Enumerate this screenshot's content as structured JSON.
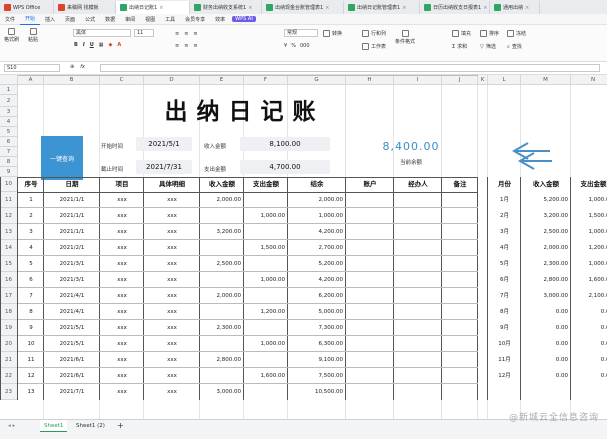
{
  "window_tabs": [
    {
      "label": "WPS Office",
      "icon": "wps-icon"
    },
    {
      "label": "来稿网 找模板",
      "icon": "docer-icon"
    },
    {
      "label": "出纳日记账1",
      "icon": "sheet-icon"
    },
    {
      "label": "财务出纳收支系统1",
      "icon": "sheet-icon"
    },
    {
      "label": "出纳现金台账管理表1",
      "icon": "sheet-icon"
    },
    {
      "label": "出纳日记账管理表1",
      "icon": "sheet-icon"
    },
    {
      "label": "日历出纳收支日报表1",
      "icon": "sheet-icon"
    },
    {
      "label": "通用出纳",
      "icon": "sheet-icon"
    }
  ],
  "menu": [
    "文件",
    "开始",
    "插入",
    "页面",
    "公式",
    "数据",
    "审阅",
    "视图",
    "工具",
    "会员专享",
    "效率"
  ],
  "menu_active": "开始",
  "ai_label": "WPS AI",
  "ribbon": {
    "format_painter": "格式刷",
    "paste": "粘贴",
    "font": "黑体",
    "size": "11",
    "number_format": "常规",
    "convert": "转换",
    "fill": "填充",
    "sort": "排序",
    "freeze": "冻结",
    "rows_cols": "行和列",
    "worksheet": "工作表",
    "cond_format": "条件格式",
    "sum": "求和",
    "filter": "筛选",
    "find": "查找"
  },
  "formula_bar": {
    "cell_ref": "S10",
    "fx": "fx"
  },
  "columns": [
    "A",
    "B",
    "C",
    "D",
    "E",
    "F",
    "G",
    "H",
    "I",
    "J",
    "K",
    "L",
    "M",
    "N"
  ],
  "row_numbers": [
    "1",
    "2",
    "3",
    "4",
    "5",
    "6",
    "7",
    "8",
    "9",
    "10",
    "11",
    "12",
    "13",
    "14",
    "15",
    "16",
    "17",
    "18",
    "19",
    "20",
    "21",
    "22",
    "23"
  ],
  "title": "出纳日记账",
  "summary": {
    "query_button": "一键查询",
    "start_label": "开始时间",
    "start_value": "2021/5/1",
    "end_label": "截止时间",
    "end_value": "2021/7/31",
    "income_label": "收入金额",
    "income_value": "8,100.00",
    "expense_label": "支出金额",
    "expense_value": "4,700.00",
    "current_amount": "8,400.00",
    "current_label": "当前余额"
  },
  "table_headers": [
    "序号",
    "日期",
    "项目",
    "具体明细",
    "收入金额",
    "支出金额",
    "结余",
    "账户",
    "经办人",
    "备注"
  ],
  "table_rows": [
    [
      "1",
      "2021/1/1",
      "xxx",
      "xxx",
      "2,000.00",
      "",
      "2,000.00",
      "",
      "",
      ""
    ],
    [
      "2",
      "2021/1/1",
      "xxx",
      "xxx",
      "",
      "1,000.00",
      "1,000.00",
      "",
      "",
      ""
    ],
    [
      "3",
      "2021/1/1",
      "xxx",
      "xxx",
      "3,200.00",
      "",
      "4,200.00",
      "",
      "",
      ""
    ],
    [
      "4",
      "2021/2/1",
      "xxx",
      "xxx",
      "",
      "1,500.00",
      "2,700.00",
      "",
      "",
      ""
    ],
    [
      "5",
      "2021/3/1",
      "xxx",
      "xxx",
      "2,500.00",
      "",
      "5,200.00",
      "",
      "",
      ""
    ],
    [
      "6",
      "2021/3/1",
      "xxx",
      "xxx",
      "",
      "1,000.00",
      "4,200.00",
      "",
      "",
      ""
    ],
    [
      "7",
      "2021/4/1",
      "xxx",
      "xxx",
      "2,000.00",
      "",
      "6,200.00",
      "",
      "",
      ""
    ],
    [
      "8",
      "2021/4/1",
      "xxx",
      "xxx",
      "",
      "1,200.00",
      "5,000.00",
      "",
      "",
      ""
    ],
    [
      "9",
      "2021/5/1",
      "xxx",
      "xxx",
      "2,300.00",
      "",
      "7,300.00",
      "",
      "",
      ""
    ],
    [
      "10",
      "2021/5/1",
      "xxx",
      "xxx",
      "",
      "1,000.00",
      "6,300.00",
      "",
      "",
      ""
    ],
    [
      "11",
      "2021/6/1",
      "xxx",
      "xxx",
      "2,800.00",
      "",
      "9,100.00",
      "",
      "",
      ""
    ],
    [
      "12",
      "2021/6/1",
      "xxx",
      "xxx",
      "",
      "1,600.00",
      "7,500.00",
      "",
      "",
      ""
    ],
    [
      "13",
      "2021/7/1",
      "xxx",
      "xxx",
      "3,000.00",
      "",
      "10,500.00",
      "",
      "",
      ""
    ]
  ],
  "month_headers": [
    "月份",
    "收入金额",
    "支出金额"
  ],
  "month_rows": [
    [
      "1月",
      "5,200.00",
      "1,000.00"
    ],
    [
      "2月",
      "3,200.00",
      "1,500.00"
    ],
    [
      "3月",
      "2,500.00",
      "1,000.00"
    ],
    [
      "4月",
      "2,000.00",
      "1,200.00"
    ],
    [
      "5月",
      "2,300.00",
      "1,000.00"
    ],
    [
      "6月",
      "2,800.00",
      "1,600.00"
    ],
    [
      "7月",
      "3,000.00",
      "2,100.00"
    ],
    [
      "8月",
      "0.00",
      "0.00"
    ],
    [
      "9月",
      "0.00",
      "0.00"
    ],
    [
      "10月",
      "0.00",
      "0.00"
    ],
    [
      "11月",
      "0.00",
      "0.00"
    ],
    [
      "12月",
      "0.00",
      "0.00"
    ]
  ],
  "sheet_tabs": [
    "Sheet1",
    "Sheet1 (2)"
  ],
  "add_sheet": "+",
  "watermark": "@新城云全信息咨询"
}
